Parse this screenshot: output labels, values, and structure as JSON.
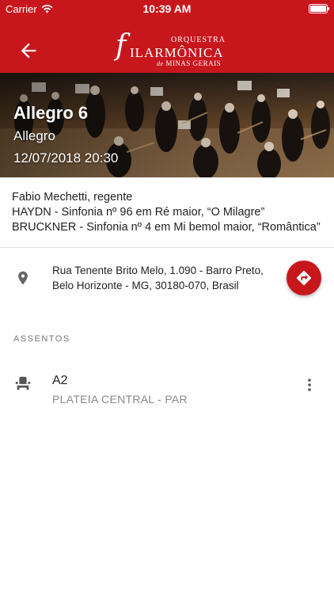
{
  "status_bar": {
    "carrier": "Carrier",
    "time": "10:39 AM"
  },
  "header": {
    "logo_top": "ORQUESTRA",
    "logo_initial": "f",
    "logo_main": "ILARMÔNICA",
    "logo_bottom_de": "de",
    "logo_bottom": "MINAS GERAIS",
    "color": "#c8161d"
  },
  "event": {
    "title": "Allegro 6",
    "series": "Allegro",
    "datetime": "12/07/2018 20:30"
  },
  "program": [
    "Fabio Mechetti, regente",
    "HAYDN - Sinfonia nº 96 em Ré maior, “O Milagre”",
    "BRUCKNER - Sinfonia nº 4 em Mi bemol maior, “Romântica”"
  ],
  "location": {
    "line1": "Rua Tenente Brito Melo, 1.090 - Barro Preto,",
    "line2": "Belo Horizonte - MG, 30180-070, Brasil"
  },
  "seats": {
    "label": "ASSENTOS",
    "items": [
      {
        "code": "A2",
        "sector": "PLATEIA CENTRAL - PAR"
      }
    ]
  },
  "icons": {
    "back": "arrow-left-icon",
    "location": "map-pin-icon",
    "directions": "directions-icon",
    "seat": "seat-icon",
    "more": "more-vertical-icon"
  }
}
